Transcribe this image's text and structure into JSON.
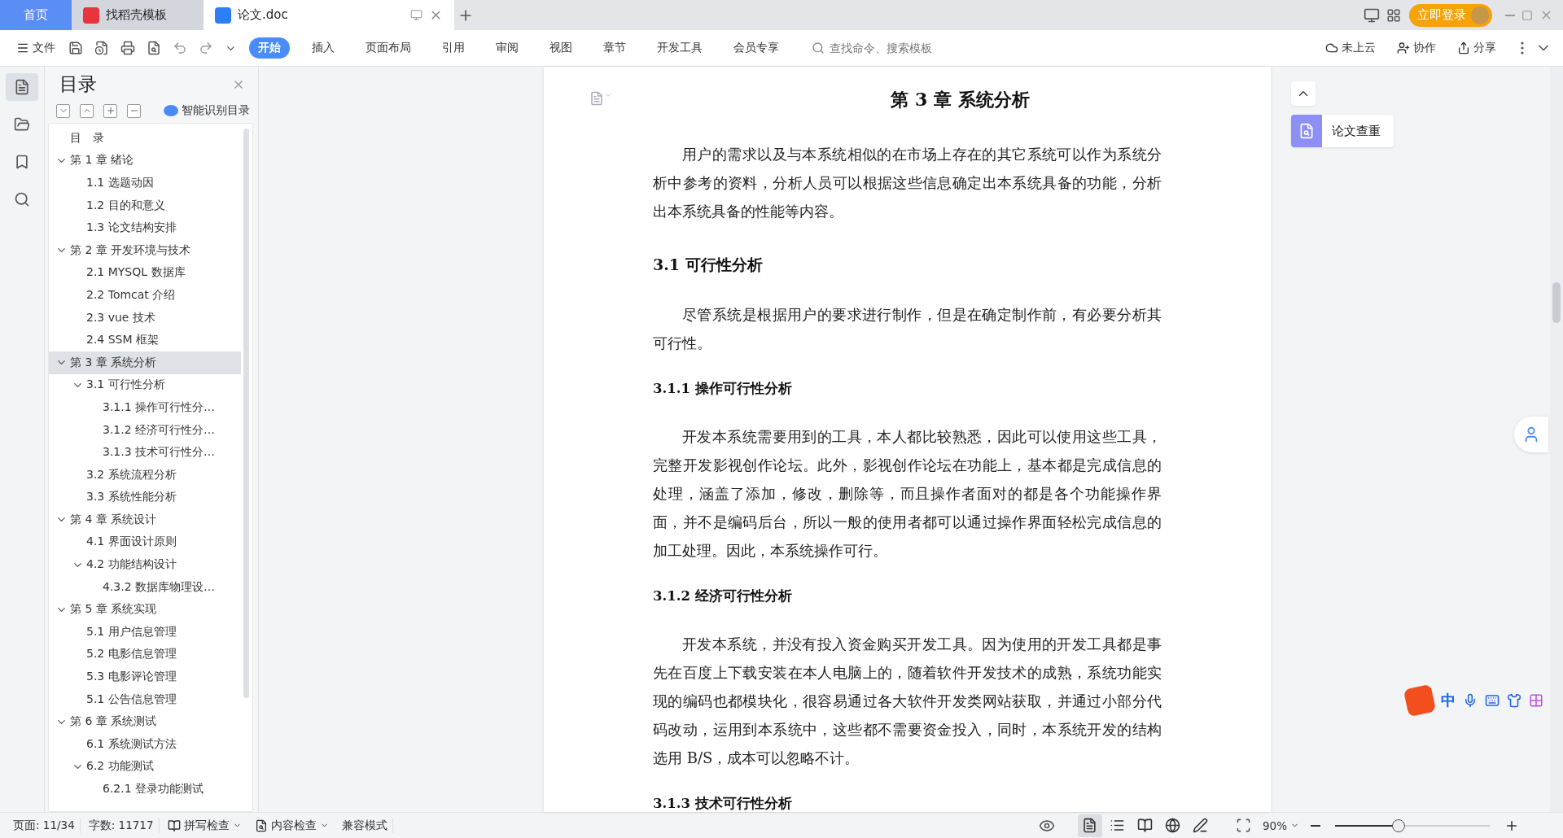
{
  "tabs": [
    {
      "label": "首页",
      "kind": "home",
      "selected": false
    },
    {
      "label": "找稻壳模板",
      "kind": "docer",
      "selected": false
    },
    {
      "label": "论文.doc",
      "kind": "doc",
      "selected": true
    }
  ],
  "login_button": "立即登录",
  "toolbar": {
    "file_menu": "文件",
    "ribbon_tabs": [
      {
        "label": "开始",
        "selected": true
      },
      {
        "label": "插入",
        "selected": false
      },
      {
        "label": "页面布局",
        "selected": false
      },
      {
        "label": "引用",
        "selected": false
      },
      {
        "label": "审阅",
        "selected": false
      },
      {
        "label": "视图",
        "selected": false
      },
      {
        "label": "章节",
        "selected": false
      },
      {
        "label": "开发工具",
        "selected": false
      },
      {
        "label": "会员专享",
        "selected": false
      }
    ],
    "search": {
      "placeholder": "查找命令、搜索模板"
    },
    "actions": [
      {
        "label": "未上云",
        "kind": "cloud"
      },
      {
        "label": "协作",
        "kind": "collab"
      },
      {
        "label": "分享",
        "kind": "share"
      }
    ]
  },
  "toc": {
    "title": "目录",
    "smart_button": "智能识别目录",
    "items": [
      {
        "label": "目　录",
        "selected": false
      },
      {
        "label": "第 1 章  绪论",
        "selected": false,
        "expanded": true,
        "children": [
          {
            "label": "1.1 选题动因",
            "selected": false
          },
          {
            "label": "1.2 目的和意义",
            "selected": false
          },
          {
            "label": "1.3 论文结构安排",
            "selected": false
          }
        ]
      },
      {
        "label": "第 2 章  开发环境与技术",
        "selected": false,
        "expanded": true,
        "children": [
          {
            "label": "2.1 MYSQL 数据库",
            "selected": false
          },
          {
            "label": "2.2 Tomcat 介绍",
            "selected": false
          },
          {
            "label": "2.3 vue 技术",
            "selected": false
          },
          {
            "label": "2.4 SSM 框架",
            "selected": false
          }
        ]
      },
      {
        "label": "第 3 章  系统分析",
        "selected": true,
        "expanded": true,
        "children": [
          {
            "label": "3.1 可行性分析",
            "selected": false,
            "expanded": true,
            "children": [
              {
                "label": "3.1.1 操作可行性分…",
                "selected": false
              },
              {
                "label": "3.1.2 经济可行性分…",
                "selected": false
              },
              {
                "label": "3.1.3 技术可行性分…",
                "selected": false
              }
            ]
          },
          {
            "label": "3.2 系统流程分析",
            "selected": false
          },
          {
            "label": "3.3 系统性能分析",
            "selected": false
          }
        ]
      },
      {
        "label": "第 4 章  系统设计",
        "selected": false,
        "expanded": true,
        "children": [
          {
            "label": "4.1 界面设计原则",
            "selected": false
          },
          {
            "label": "4.2 功能结构设计",
            "selected": false,
            "expanded": true,
            "children": [
              {
                "label": "4.3.2 数据库物理设…",
                "selected": false
              }
            ]
          }
        ]
      },
      {
        "label": "第 5 章  系统实现",
        "selected": false,
        "expanded": true,
        "children": [
          {
            "label": "5.1 用户信息管理",
            "selected": false
          },
          {
            "label": "5.2  电影信息管理",
            "selected": false
          },
          {
            "label": "5.3 电影评论管理",
            "selected": false
          },
          {
            "label": "5.1 公告信息管理",
            "selected": false
          }
        ]
      },
      {
        "label": "第 6 章  系统测试",
        "selected": false,
        "expanded": true,
        "children": [
          {
            "label": "6.1 系统测试方法",
            "selected": false
          },
          {
            "label": "6.2 功能测试",
            "selected": false,
            "expanded": true,
            "children": [
              {
                "label": "6.2.1 登录功能测试",
                "selected": false
              }
            ]
          }
        ]
      }
    ]
  },
  "document": {
    "blocks": [
      {
        "kind": "title",
        "text": "第 3 章  系统分析"
      },
      {
        "kind": "paragraph",
        "text": "用户的需求以及与本系统相似的在市场上存在的其它系统可以作为系统分析中参考的资料，分析人员可以根据这些信息确定出本系统具备的功能，分析出本系统具备的性能等内容。"
      },
      {
        "kind": "heading2",
        "text": "3.1 可行性分析"
      },
      {
        "kind": "paragraph",
        "text": "尽管系统是根据用户的要求进行制作，但是在确定制作前，有必要分析其可行性。"
      },
      {
        "kind": "heading3",
        "text": "3.1.1 操作可行性分析"
      },
      {
        "kind": "paragraph",
        "text": "开发本系统需要用到的工具，本人都比较熟悉，因此可以使用这些工具，完整开发影视创作论坛。此外，影视创作论坛在功能上，基本都是完成信息的处理，涵盖了添加，修改，删除等，而且操作者面对的都是各个功能操作界面，并不是编码后台，所以一般的使用者都可以通过操作界面轻松完成信息的加工处理。因此，本系统操作可行。"
      },
      {
        "kind": "heading3",
        "text": "3.1.2 经济可行性分析"
      },
      {
        "kind": "paragraph",
        "text": "开发本系统，并没有投入资金购买开发工具。因为使用的开发工具都是事先在百度上下载安装在本人电脑上的，随着软件开发技术的成熟，系统功能实现的编码也都模块化，很容易通过各大软件开发类网站获取，并通过小部分代码改动，运用到本系统中，这些都不需要资金投入，同时，本系统开发的结构选用 B/S，成本可以忽略不计。"
      },
      {
        "kind": "heading3",
        "text": "3.1.3 技术可行性分析"
      }
    ]
  },
  "side_button": "论文查重",
  "ime_bar": {
    "label": "中"
  },
  "status_bar": {
    "page": "页面: 11/34",
    "words": "字数: 11717",
    "spell_check": "拼写检查",
    "content_check": "内容检查",
    "mode": "兼容模式",
    "views": [
      {
        "kind": "page",
        "selected": true
      },
      {
        "kind": "outline",
        "selected": false
      },
      {
        "kind": "reading",
        "selected": false
      },
      {
        "kind": "web",
        "selected": false
      },
      {
        "kind": "pen",
        "selected": false
      }
    ],
    "zoom": "90%",
    "zoom_slider": {
      "level": 0.4
    }
  }
}
